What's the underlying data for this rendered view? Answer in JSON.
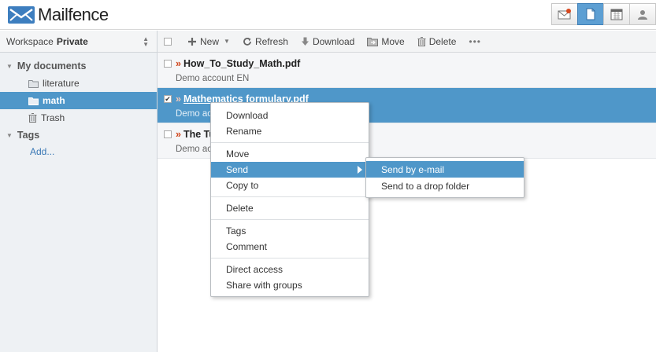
{
  "app": {
    "name": "Mailfence",
    "brand_color": "#3d7ebf",
    "accent_color": "#4f97c9"
  },
  "header": {
    "switcher": [
      {
        "icon": "mail-icon"
      },
      {
        "icon": "documents-icon"
      },
      {
        "icon": "calendar-icon"
      },
      {
        "icon": "contacts-icon"
      }
    ]
  },
  "sidebar": {
    "workspace_label": "Workspace",
    "workspace_value": "Private",
    "my_documents": "My documents",
    "folders": [
      {
        "label": "literature",
        "icon": "folder-icon"
      },
      {
        "label": "math",
        "icon": "folder-icon",
        "selected": true
      },
      {
        "label": "Trash",
        "icon": "trash-icon"
      }
    ],
    "tags": "Tags",
    "add_tag": "Add..."
  },
  "toolbar": {
    "new": "New",
    "refresh": "Refresh",
    "download": "Download",
    "move": "Move",
    "delete": "Delete",
    "more": "•••"
  },
  "documents": [
    {
      "name": "How_To_Study_Math.pdf",
      "owner": "Demo account EN",
      "checked": false
    },
    {
      "name": "Mathematics formulary.pdf",
      "owner": "Demo acco",
      "checked": true
    },
    {
      "name": "The Tu",
      "owner": "Demo acco",
      "checked": false
    }
  ],
  "context_menu": {
    "download": "Download",
    "rename": "Rename",
    "move": "Move",
    "send": "Send",
    "copy_to": "Copy to",
    "delete": "Delete",
    "tags": "Tags",
    "comment": "Comment",
    "direct_access": "Direct access",
    "share_with_groups": "Share with groups"
  },
  "send_submenu": {
    "by_email": "Send by e-mail",
    "to_drop_folder": "Send to a drop folder"
  }
}
